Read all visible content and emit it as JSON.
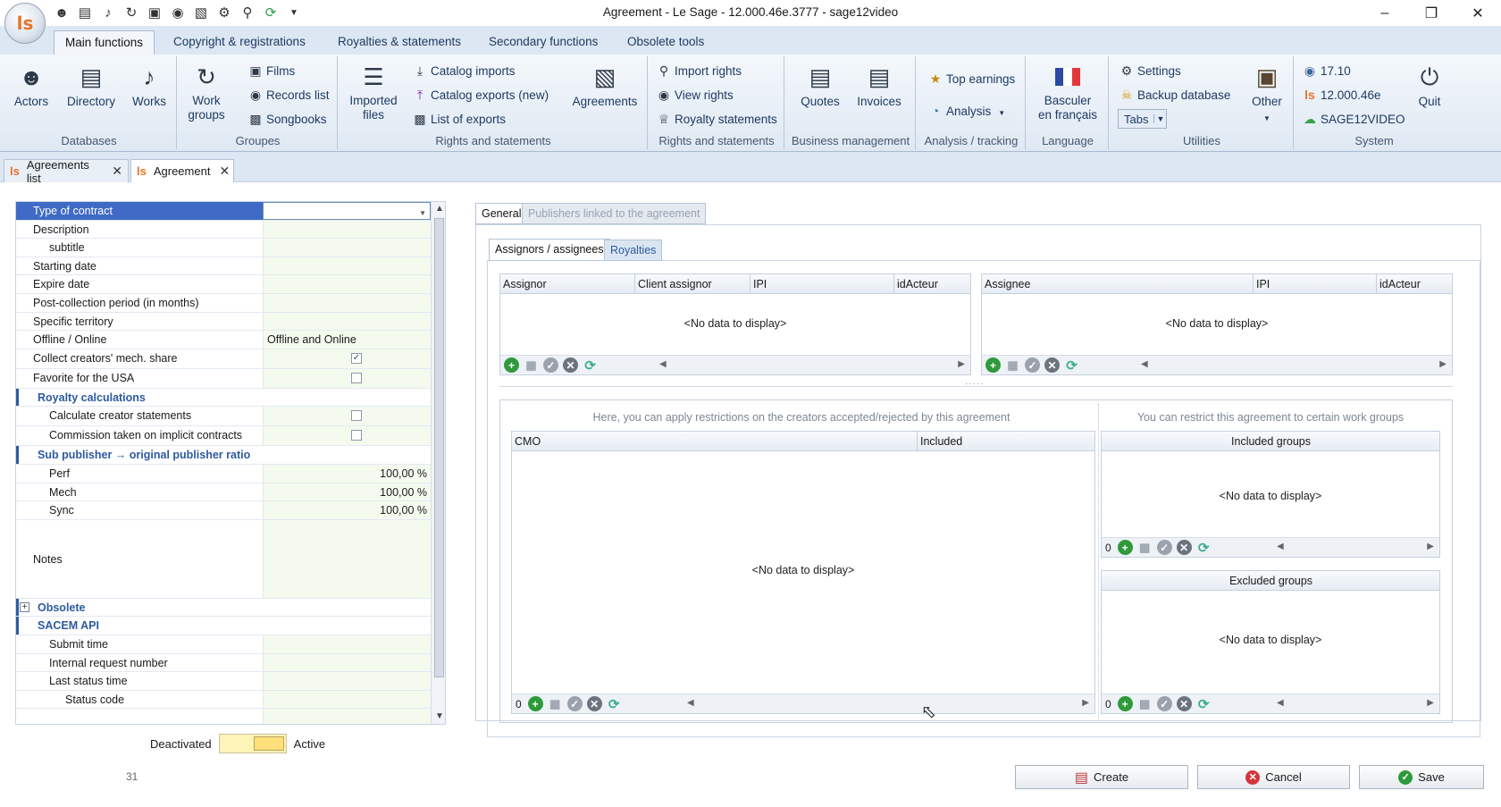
{
  "window": {
    "title": "Agreement - Le Sage - 12.000.46e.3777 - sage12video",
    "app_logo": "ls"
  },
  "ribbon_tabs": [
    "Main functions",
    "Copyright & registrations",
    "Royalties & statements",
    "Secondary functions",
    "Obsolete tools"
  ],
  "ribbon": {
    "databases": {
      "label": "Databases",
      "actors": "Actors",
      "directory": "Directory",
      "works": "Works"
    },
    "groupes": {
      "label": "Groupes",
      "work_groups_1": "Work",
      "work_groups_2": "groups",
      "films": "Films",
      "records_list": "Records list",
      "songbooks": "Songbooks"
    },
    "rights1": {
      "label": "Rights and statements",
      "imported_1": "Imported",
      "imported_2": "files",
      "catalog_imports": "Catalog imports",
      "catalog_exports": "Catalog exports (new)",
      "list_of_exports": "List of exports",
      "agreements": "Agreements"
    },
    "rights2": {
      "label": "Rights and statements",
      "import_rights": "Import rights",
      "view_rights": "View rights",
      "royalty_statements": "Royalty statements"
    },
    "business": {
      "label": "Business management",
      "quotes": "Quotes",
      "invoices": "Invoices"
    },
    "analysis": {
      "label": "Analysis / tracking",
      "top_earnings": "Top earnings",
      "analysis": "Analysis"
    },
    "language": {
      "label": "Language",
      "btn_1": "Basculer",
      "btn_2": "en français"
    },
    "utilities": {
      "label": "Utilities",
      "settings": "Settings",
      "backup": "Backup database",
      "tabs": "Tabs",
      "other": "Other"
    },
    "system": {
      "label": "System",
      "v1": "17.10",
      "v2": "12.000.46e",
      "v3": "SAGE12VIDEO",
      "quit": "Quit"
    }
  },
  "doc_tabs": [
    "Agreements list",
    "Agreement"
  ],
  "properties": {
    "type_of_contract": "Type of contract",
    "description": "Description",
    "subtitle": "subtitle",
    "starting_date": "Starting date",
    "expire_date": "Expire date",
    "post_collection": "Post-collection period (in months)",
    "specific_territory": "Specific territory",
    "offline_online": "Offline / Online",
    "offline_online_value": "Offline and Online",
    "collect_mech": "Collect creators' mech. share",
    "collect_mech_checked": true,
    "favorite_usa": "Favorite for the USA",
    "favorite_usa_checked": false,
    "royalty_calc": "Royalty calculations",
    "calc_creator": "Calculate creator statements",
    "commission_implicit": "Commission taken on implicit contracts",
    "sub_publisher_ratio": "Sub publisher → original publisher ratio",
    "perf": "Perf",
    "perf_value": "100,00 %",
    "mech": "Mech",
    "mech_value": "100,00 %",
    "sync": "Sync",
    "sync_value": "100,00 %",
    "notes": "Notes",
    "obsolete": "Obsolete",
    "sacem_api": "SACEM API",
    "submit_time": "Submit time",
    "internal_request": "Internal request number",
    "last_status_time": "Last status time",
    "status_code": "Status code"
  },
  "status": {
    "deactivated": "Deactivated",
    "active": "Active",
    "record_id": "31"
  },
  "panel_tabs": {
    "general": "General",
    "publishers_linked": "Publishers linked to the agreement"
  },
  "inner_tabs": {
    "assignors": "Assignors / assignees",
    "royalties": "Royalties"
  },
  "assignor_grid": {
    "columns": [
      "Assignor",
      "Client assignor",
      "IPI",
      "idActeur"
    ],
    "empty": "<No data to display>"
  },
  "assignee_grid": {
    "columns": [
      "Assignee",
      "IPI",
      "idActeur"
    ],
    "empty": "<No data to display>"
  },
  "restrictions": {
    "creators_hint": "Here, you can apply restrictions on the creators accepted/rejected by this agreement",
    "groups_hint": "You can restrict this agreement to certain work groups",
    "cmo_columns": [
      "CMO",
      "Included"
    ],
    "cmo_empty": "<No data to display>",
    "cmo_count": "0",
    "included_groups": "Included groups",
    "included_empty": "<No data to display>",
    "included_count": "0",
    "excluded_groups": "Excluded groups",
    "excluded_empty": "<No data to display>",
    "excluded_count": "0"
  },
  "actions": {
    "create": "Create",
    "cancel": "Cancel",
    "save": "Save"
  }
}
